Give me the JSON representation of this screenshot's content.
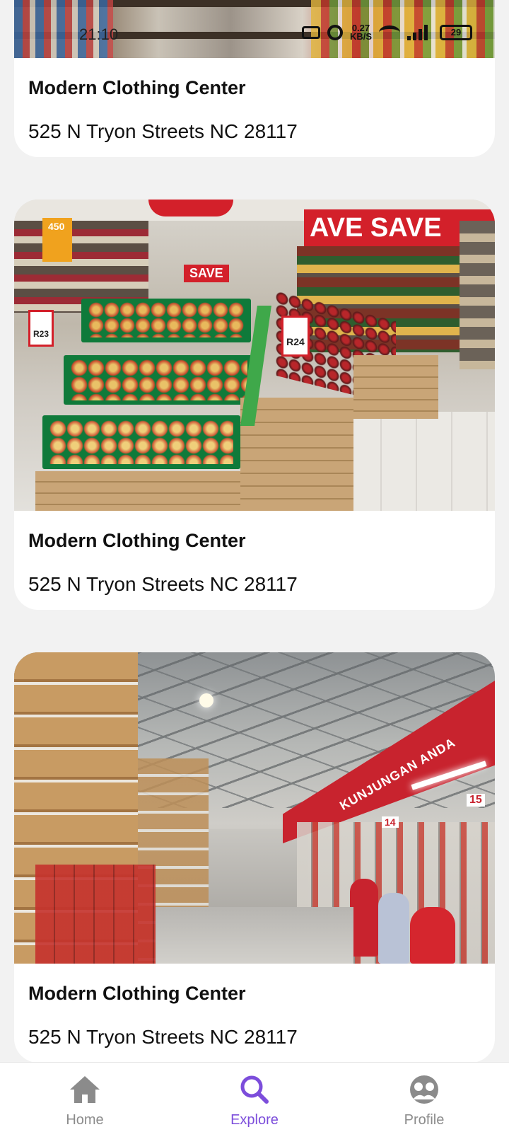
{
  "status_bar": {
    "time": "21:10",
    "speed_value": "0.27",
    "speed_unit": "KB/S",
    "battery": "29"
  },
  "cards": [
    {
      "title": "Modern Clothing Center",
      "address": "525 N Tryon Streets NC 28117",
      "image": "supermarket-aisle-photo"
    },
    {
      "title": "Modern Clothing Center",
      "address": "525 N Tryon Streets NC 28117",
      "image": "fruit-display-photo",
      "sign_texts": [
        "SAVE",
        "AVE",
        "SAVE",
        "R24",
        "R23",
        "450"
      ]
    },
    {
      "title": "Modern Clothing Center",
      "address": "525 N Tryon Streets NC 28117",
      "image": "warehouse-store-photo",
      "banner_text": "KUNJUNGAN ANDA",
      "aisle_numbers": [
        "14",
        "15"
      ]
    }
  ],
  "nav": {
    "items": [
      {
        "label": "Home",
        "icon": "home-icon",
        "active": false
      },
      {
        "label": "Explore",
        "icon": "search-icon",
        "active": true
      },
      {
        "label": "Profile",
        "icon": "profile-icon",
        "active": false
      }
    ],
    "active_color": "#7c4ddb",
    "inactive_color": "#8b8b8b"
  }
}
